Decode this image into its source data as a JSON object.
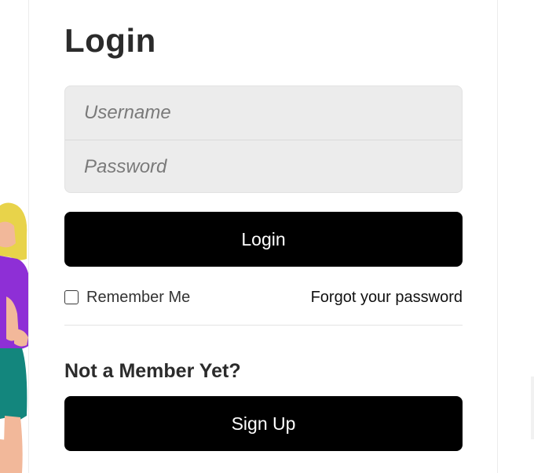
{
  "login": {
    "title": "Login",
    "username_placeholder": "Username",
    "password_placeholder": "Password",
    "login_button": "Login",
    "remember_me": "Remember Me",
    "remember_checked": false,
    "forgot_password": "Forgot your password"
  },
  "signup": {
    "heading": "Not a Member Yet?",
    "button": "Sign Up"
  },
  "colors": {
    "button_bg": "#000000",
    "button_text": "#ffffff",
    "input_bg": "#ececec",
    "heading_text": "#2b2b2b",
    "illustration_shirt": "#8e2fd6",
    "illustration_hair": "#e8d34a",
    "illustration_skin": "#f2b89a",
    "illustration_pants": "#13867d"
  }
}
